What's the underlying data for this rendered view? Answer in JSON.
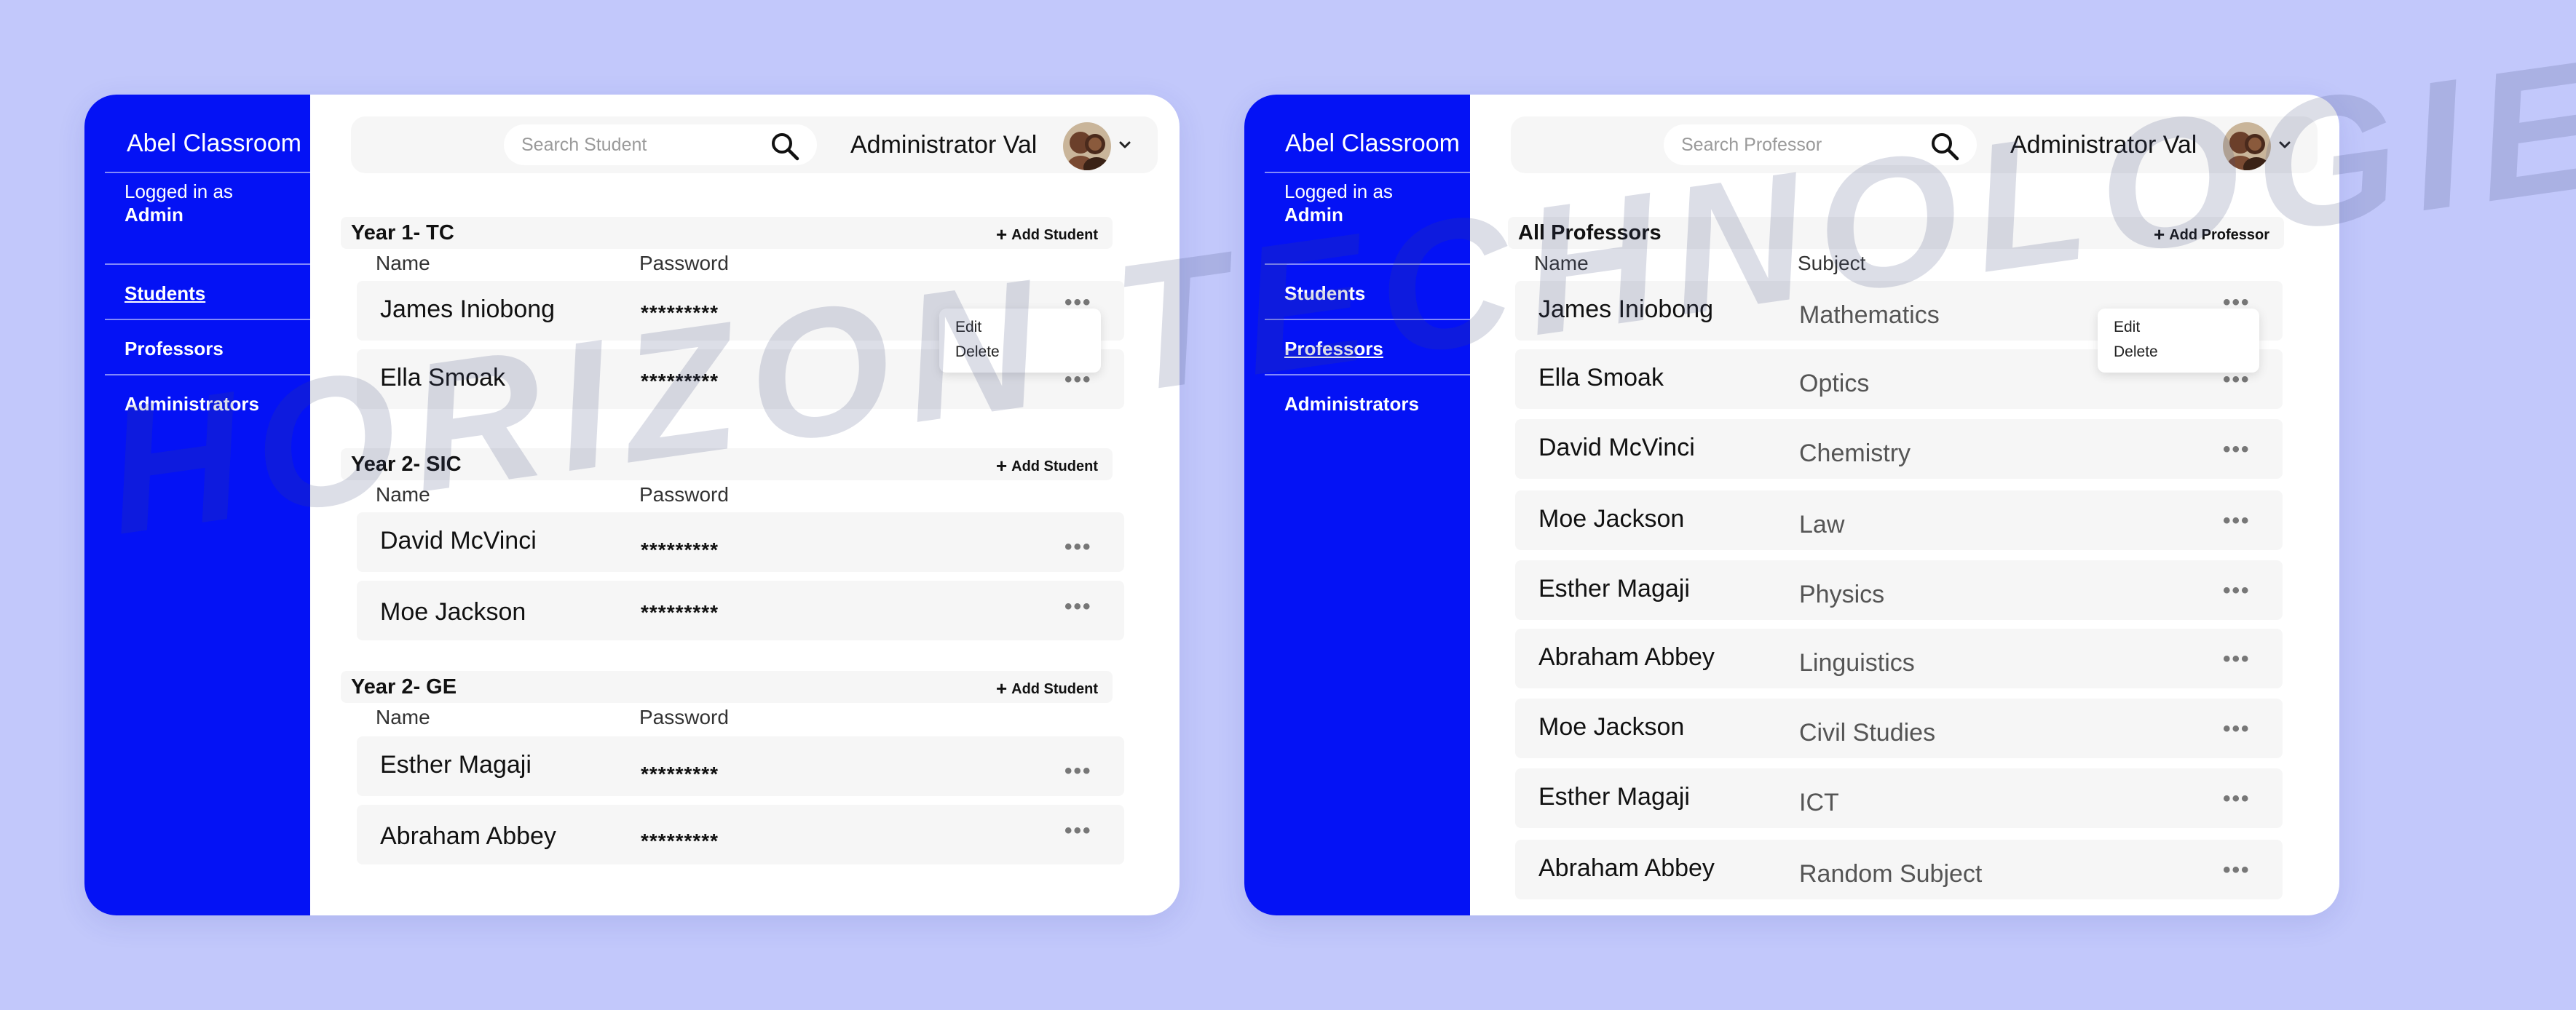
{
  "colors": {
    "background": "#c2c8fb",
    "sidebar": "#0412f5",
    "row": "#f6f6f6",
    "card": "#ffffff"
  },
  "watermark": "HORIZON TECHNOLOGIES",
  "left_panel": {
    "brand": "Abel Classroom",
    "logged_in_label": "Logged in as",
    "logged_in_role": "Admin",
    "nav": [
      {
        "label": "Students",
        "active": true
      },
      {
        "label": "Professors",
        "active": false
      },
      {
        "label": "Administrators",
        "active": false
      }
    ],
    "search_placeholder": "Search Student",
    "admin_name": "Administrator Val",
    "sections": [
      {
        "title": "Year 1- TC",
        "add_label": "Add Student",
        "col_name": "Name",
        "col_second": "Password",
        "rows": [
          {
            "name": "James Iniobong",
            "value": "*********"
          },
          {
            "name": "Ella Smoak",
            "value": "*********"
          }
        ]
      },
      {
        "title": "Year 2- SIC",
        "add_label": "Add Student",
        "col_name": "Name",
        "col_second": "Password",
        "rows": [
          {
            "name": "David McVinci",
            "value": "*********"
          },
          {
            "name": "Moe Jackson",
            "value": "*********"
          }
        ]
      },
      {
        "title": "Year 2- GE",
        "add_label": "Add Student",
        "col_name": "Name",
        "col_second": "Password",
        "rows": [
          {
            "name": "Esther Magaji",
            "value": "*********"
          },
          {
            "name": "Abraham Abbey",
            "value": "*********"
          }
        ]
      }
    ],
    "menu": {
      "edit": "Edit",
      "delete": "Delete"
    }
  },
  "right_panel": {
    "brand": "Abel Classroom",
    "logged_in_label": "Logged in as",
    "logged_in_role": "Admin",
    "nav": [
      {
        "label": "Students",
        "active": false
      },
      {
        "label": "Professors",
        "active": true
      },
      {
        "label": "Administrators",
        "active": false
      }
    ],
    "search_placeholder": "Search Professor",
    "admin_name": "Administrator Val",
    "section": {
      "title": "All Professors",
      "add_label": "Add Professor",
      "col_name": "Name",
      "col_second": "Subject"
    },
    "rows": [
      {
        "name": "James Iniobong",
        "subject": "Mathematics"
      },
      {
        "name": "Ella Smoak",
        "subject": "Optics"
      },
      {
        "name": "David McVinci",
        "subject": "Chemistry"
      },
      {
        "name": "Moe Jackson",
        "subject": "Law"
      },
      {
        "name": "Esther Magaji",
        "subject": "Physics"
      },
      {
        "name": "Abraham Abbey",
        "subject": "Linguistics"
      },
      {
        "name": "Moe Jackson",
        "subject": "Civil Studies"
      },
      {
        "name": "Esther Magaji",
        "subject": "ICT"
      },
      {
        "name": "Abraham Abbey",
        "subject": "Random Subject"
      }
    ],
    "menu": {
      "edit": "Edit",
      "delete": "Delete"
    }
  }
}
